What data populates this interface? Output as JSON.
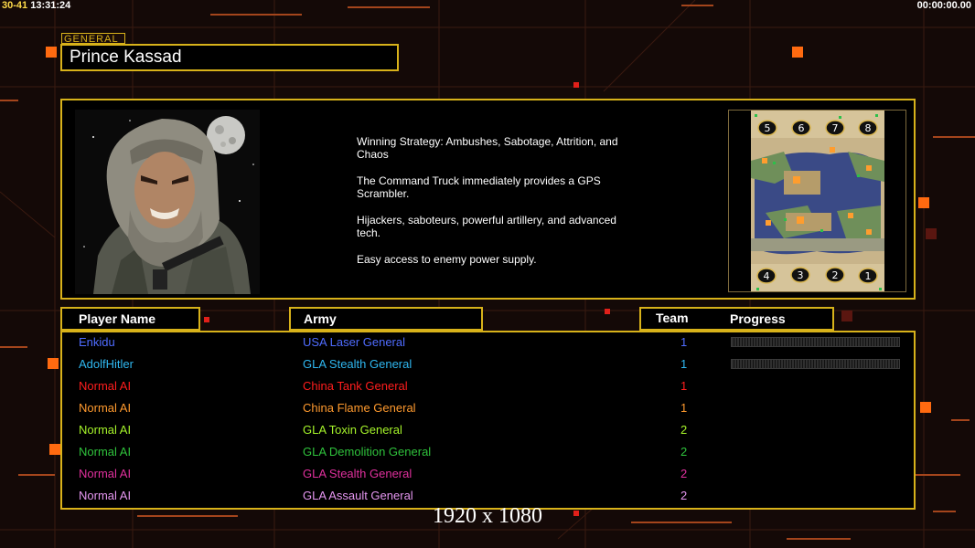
{
  "hud": {
    "left_time": "13:31:24",
    "right_time": "00:00:00.00"
  },
  "general": {
    "tag": "GENERAL",
    "name": "Prince Kassad",
    "strategy": [
      "Winning Strategy: Ambushes, Sabotage, Attrition, and Chaos",
      "The Command Truck immediately provides a GPS Scrambler.",
      "Hijackers, saboteurs, powerful artillery, and advanced tech.",
      "Easy access to enemy power supply."
    ]
  },
  "map": {
    "top_slots": [
      "5",
      "6",
      "7",
      "8"
    ],
    "bottom_slots": [
      "4",
      "3",
      "2",
      "1"
    ]
  },
  "headers": {
    "player_name": "Player Name",
    "army": "Army",
    "team": "Team",
    "progress": "Progress"
  },
  "players": [
    {
      "name": "Enkidu",
      "army": "USA Laser General",
      "team": "1",
      "color": "#4f6cff",
      "bar": true
    },
    {
      "name": "AdolfHitler",
      "army": "GLA Stealth General",
      "team": "1",
      "color": "#2fb7f0",
      "bar": true
    },
    {
      "name": "Normal AI",
      "army": "China Tank General",
      "team": "1",
      "color": "#ff1d1d",
      "bar": false
    },
    {
      "name": "Normal AI",
      "army": "China Flame General",
      "team": "1",
      "color": "#ff9a2e",
      "bar": false
    },
    {
      "name": "Normal AI",
      "army": "GLA Toxin General",
      "team": "2",
      "color": "#a6f52a",
      "bar": false
    },
    {
      "name": "Normal AI",
      "army": "GLA Demolition General",
      "team": "2",
      "color": "#2fc23c",
      "bar": false
    },
    {
      "name": "Normal AI",
      "army": "GLA Stealth General",
      "team": "2",
      "color": "#e0309d",
      "bar": false
    },
    {
      "name": "Normal AI",
      "army": "GLA Assault General",
      "team": "2",
      "color": "#e596f0",
      "bar": false
    }
  ],
  "resolution": "1920 x 1080"
}
